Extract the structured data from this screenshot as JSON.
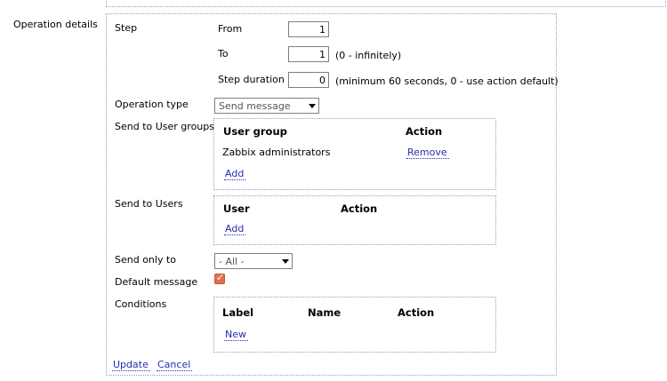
{
  "section_label": "Operation details",
  "step": {
    "label": "Step",
    "from_label": "From",
    "from_value": "1",
    "to_label": "To",
    "to_value": "1",
    "to_hint": "(0 - infinitely)",
    "duration_label": "Step duration",
    "duration_value": "0",
    "duration_hint": "(minimum 60 seconds, 0 - use action default)"
  },
  "operation_type": {
    "label": "Operation type",
    "value": "Send message"
  },
  "user_groups": {
    "label": "Send to User groups",
    "col_group": "User group",
    "col_action": "Action",
    "rows": [
      {
        "name": "Zabbix administrators",
        "action": "Remove"
      }
    ],
    "add": "Add"
  },
  "users": {
    "label": "Send to Users",
    "col_user": "User",
    "col_action": "Action",
    "add": "Add"
  },
  "send_only_to": {
    "label": "Send only to",
    "value": "- All -"
  },
  "default_message": {
    "label": "Default message",
    "checked": true
  },
  "conditions": {
    "label": "Conditions",
    "col_label": "Label",
    "col_name": "Name",
    "col_action": "Action",
    "new": "New"
  },
  "buttons": {
    "update": "Update",
    "cancel": "Cancel"
  },
  "colors": {
    "link": "#2b2bb3",
    "border": "#8ea3c0",
    "checkbox": "#e07050"
  }
}
